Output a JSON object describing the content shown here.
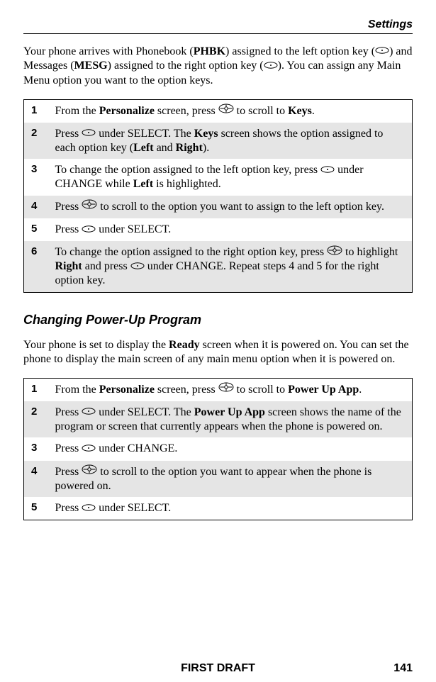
{
  "header": {
    "section": "Settings"
  },
  "intro": {
    "t1": "Your phone arrives with Phonebook (",
    "phbk": "PHBK",
    "t2": ") assigned to the left option key (",
    "t3": ") and Messages (",
    "mesg": "MESG",
    "t4": ") assigned to the right option key (",
    "t5": "). You can assign any Main Menu option you want to the option keys."
  },
  "table1": [
    {
      "n": "1",
      "segments": [
        {
          "t": "From the "
        },
        {
          "b": "Personalize"
        },
        {
          "t": " screen, press "
        },
        {
          "icon": "nav"
        },
        {
          "t": " to scroll to "
        },
        {
          "b": "Keys"
        },
        {
          "t": "."
        }
      ]
    },
    {
      "n": "2",
      "shade": true,
      "segments": [
        {
          "t": "Press "
        },
        {
          "icon": "pill"
        },
        {
          "t": " under SELECT. The "
        },
        {
          "b": "Keys"
        },
        {
          "t": " screen shows the option assigned to each option key ("
        },
        {
          "b": "Left"
        },
        {
          "t": " and "
        },
        {
          "b": "Right"
        },
        {
          "t": ")."
        }
      ]
    },
    {
      "n": "3",
      "segments": [
        {
          "t": "To change the option assigned to the left option key, press "
        },
        {
          "icon": "pill"
        },
        {
          "t": " under CHANGE while "
        },
        {
          "b": "Left"
        },
        {
          "t": " is highlighted."
        }
      ]
    },
    {
      "n": "4",
      "shade": true,
      "segments": [
        {
          "t": "Press "
        },
        {
          "icon": "nav"
        },
        {
          "t": " to scroll to the option you want to assign to the left option key."
        }
      ]
    },
    {
      "n": "5",
      "segments": [
        {
          "t": "Press "
        },
        {
          "icon": "pill"
        },
        {
          "t": " under SELECT."
        }
      ]
    },
    {
      "n": "6",
      "shade": true,
      "segments": [
        {
          "t": "To change the option assigned to the right option key, press "
        },
        {
          "icon": "nav"
        },
        {
          "t": " to highlight "
        },
        {
          "b": "Right"
        },
        {
          "t": " and press "
        },
        {
          "icon": "pill"
        },
        {
          "t": " under CHANGE. Repeat steps 4 and 5 for the right option key."
        }
      ]
    }
  ],
  "subheading": "Changing Power-Up Program",
  "intro2": {
    "t1": "Your phone is set to display the ",
    "ready": "Ready",
    "t2": " screen when it is powered on. You can set the phone to display the main screen of any main menu option when it is powered on."
  },
  "table2": [
    {
      "n": "1",
      "segments": [
        {
          "t": "From the "
        },
        {
          "b": "Personalize"
        },
        {
          "t": " screen, press "
        },
        {
          "icon": "nav"
        },
        {
          "t": " to scroll to "
        },
        {
          "b": "Power Up App"
        },
        {
          "t": "."
        }
      ]
    },
    {
      "n": "2",
      "shade": true,
      "segments": [
        {
          "t": "Press "
        },
        {
          "icon": "pill"
        },
        {
          "t": " under SELECT. The "
        },
        {
          "b": "Power Up App"
        },
        {
          "t": " screen shows the name of the program or screen that currently appears when the phone is powered on."
        }
      ]
    },
    {
      "n": "3",
      "segments": [
        {
          "t": "Press "
        },
        {
          "icon": "pill"
        },
        {
          "t": " under CHANGE."
        }
      ]
    },
    {
      "n": "4",
      "shade": true,
      "segments": [
        {
          "t": "Press "
        },
        {
          "icon": "nav"
        },
        {
          "t": " to scroll to the option you want to appear when the phone is powered on."
        }
      ]
    },
    {
      "n": "5",
      "segments": [
        {
          "t": "Press "
        },
        {
          "icon": "pill"
        },
        {
          "t": " under SELECT."
        }
      ]
    }
  ],
  "footer": {
    "draft": "FIRST DRAFT",
    "page": "141"
  }
}
